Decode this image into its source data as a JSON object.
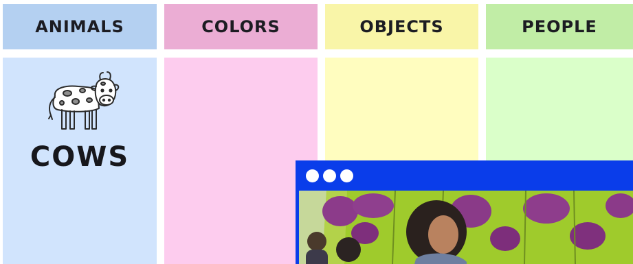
{
  "categories": [
    {
      "id": "animals",
      "label": "ANIMALS",
      "header_color": "#b4d0f1",
      "card_color": "#d1e4fd"
    },
    {
      "id": "colors",
      "label": "COLORS",
      "header_color": "#ebadd4",
      "card_color": "#fdccee"
    },
    {
      "id": "objects",
      "label": "OBJECTS",
      "header_color": "#f9f5a8",
      "card_color": "#fffdbf"
    },
    {
      "id": "people",
      "label": "PEOPLE",
      "header_color": "#c1eda6",
      "card_color": "#daffc9"
    }
  ],
  "animals_card": {
    "word": "COWS",
    "image": "cow-illustration"
  },
  "video_window": {
    "chrome_color": "#0a3dea",
    "window_controls": [
      "dot",
      "dot",
      "dot"
    ],
    "content": "video-frame"
  }
}
